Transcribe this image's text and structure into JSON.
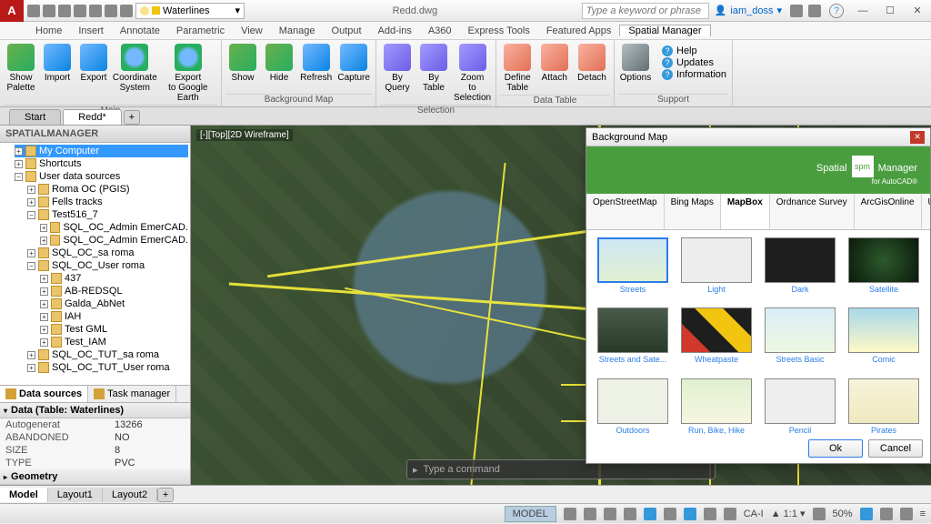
{
  "app": {
    "badge": "A",
    "title": "Redd.dwg",
    "search_placeholder": "Type a keyword or phrase",
    "user": "iam_doss"
  },
  "qat_layer": "Waterlines",
  "menus": [
    "Home",
    "Insert",
    "Annotate",
    "Parametric",
    "View",
    "Manage",
    "Output",
    "Add-ins",
    "A360",
    "Express Tools",
    "Featured Apps",
    "Spatial Manager"
  ],
  "active_menu": "Spatial Manager",
  "ribbon": {
    "main": {
      "title": "Main",
      "items": [
        "Show Palette",
        "Import",
        "Export",
        "Coordinate System",
        "Export to Google Earth"
      ]
    },
    "bg": {
      "title": "Background Map",
      "items": [
        "Show",
        "Hide",
        "Refresh",
        "Capture"
      ]
    },
    "sel": {
      "title": "Selection",
      "items": [
        "By Query",
        "By Table",
        "Zoom to Selection"
      ]
    },
    "dt": {
      "title": "Data Table",
      "items": [
        "Define Table",
        "Attach",
        "Detach"
      ]
    },
    "sup": {
      "title": "Support",
      "opts": "Options",
      "links": [
        "Help",
        "Updates",
        "Information"
      ]
    }
  },
  "doc_tabs": {
    "items": [
      "Start",
      "Redd*"
    ],
    "active": "Redd*"
  },
  "side_panel": {
    "title": "SPATIALMANAGER",
    "nodes": [
      "My Computer",
      "Shortcuts",
      "User data sources",
      "Roma OC (PGIS)",
      "Fells tracks",
      "Test516_7",
      "SQL_OC_Admin EmerCAD.",
      "SQL_OC_Admin EmerCAD.",
      "SQL_OC_sa roma",
      "SQL_OC_User roma",
      "437",
      "AB-REDSQL",
      "Galda_AbNet",
      "IAH",
      "Test GML",
      "Test_IAM",
      "SQL_OC_TUT_sa roma",
      "SQL_OC_TUT_User roma"
    ],
    "tabs": [
      "Data sources",
      "Task manager"
    ],
    "data_header": "Data (Table: Waterlines)",
    "rows": [
      [
        "Autogenerat",
        "13266"
      ],
      [
        "ABANDONED",
        "NO"
      ],
      [
        "SIZE",
        "8"
      ],
      [
        "TYPE",
        "PVC"
      ]
    ],
    "geom_header": "Geometry"
  },
  "view_label": "[-][Top][2D Wireframe]",
  "cmd_placeholder": "Type a command",
  "dialog": {
    "title": "Background Map",
    "brand_a": "Spatial",
    "brand_b": "Manager",
    "brand_sub": "for AutoCAD®",
    "providers": [
      "OpenStreetMap",
      "Bing Maps",
      "MapBox",
      "Ordnance Survey",
      "ArcGisOnline",
      "USGS"
    ],
    "active_provider": "MapBox",
    "maps": [
      "Streets",
      "Light",
      "Dark",
      "Satellite",
      "Streets and Sate...",
      "Wheatpaste",
      "Streets Basic",
      "Comic",
      "Outdoors",
      "Run, Bike, Hike",
      "Pencil",
      "Pirates"
    ],
    "selected_map": "Streets",
    "ok": "Ok",
    "cancel": "Cancel"
  },
  "bottom_tabs": {
    "items": [
      "Model",
      "Layout1",
      "Layout2"
    ],
    "active": "Model"
  },
  "status": {
    "model": "MODEL",
    "cai": "CA-I",
    "scale": "1:1",
    "zoom": "50%"
  },
  "thumb_colors": {
    "Streets": "linear-gradient(#cfe7f5,#e0efd0)",
    "Light": "#ededed",
    "Dark": "#1e1e1e",
    "Satellite": "radial-gradient(circle,#2d5a2d,#0b1a0b)",
    "Streets and Sate...": "linear-gradient(#4a5a4a,#2a3a2a)",
    "Wheatpaste": "linear-gradient(45deg,#d0392b 25%,#1e1e1e 25% 50%,#f1c40f 50% 75%,#1e1e1e 75%)",
    "Streets Basic": "linear-gradient(#d9edf7,#eef7e0)",
    "Comic": "linear-gradient(#a8d8ea,#fef9c7)",
    "Outdoors": "#eef2e6",
    "Run, Bike, Hike": "linear-gradient(#e0f0d0,#f6f6e0)",
    "Pencil": "#eeeeee",
    "Pirates": "linear-gradient(#f7f3da,#efe9c0)"
  }
}
